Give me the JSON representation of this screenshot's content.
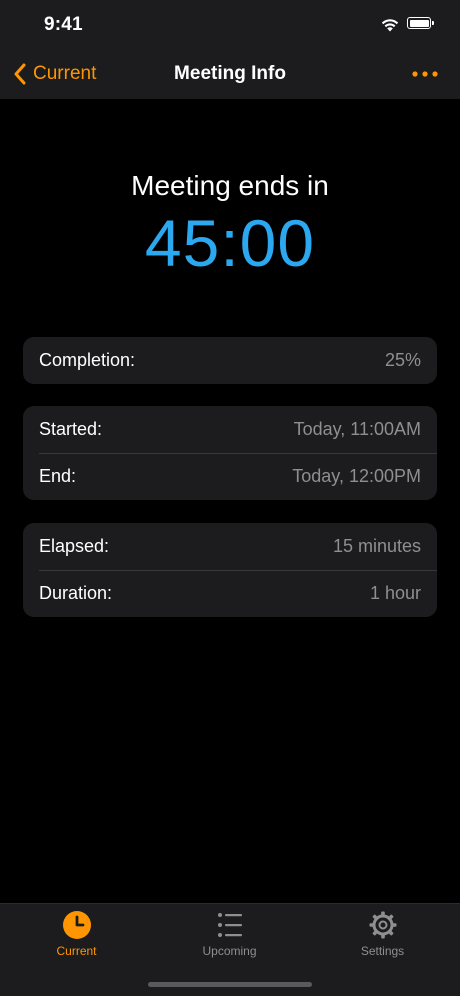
{
  "status_bar": {
    "time": "9:41"
  },
  "nav": {
    "back_label": "Current",
    "title": "Meeting Info"
  },
  "main": {
    "headline": "Meeting ends in",
    "countdown": "45:00"
  },
  "cards": [
    {
      "rows": [
        {
          "label": "Completion:",
          "value": "25%"
        }
      ]
    },
    {
      "rows": [
        {
          "label": "Started:",
          "value": "Today, 11:00AM"
        },
        {
          "label": "End:",
          "value": "Today, 12:00PM"
        }
      ]
    },
    {
      "rows": [
        {
          "label": "Elapsed:",
          "value": "15 minutes"
        },
        {
          "label": "Duration:",
          "value": "1 hour"
        }
      ]
    }
  ],
  "tabs": [
    {
      "label": "Current",
      "icon": "clock-icon",
      "active": true
    },
    {
      "label": "Upcoming",
      "icon": "list-icon",
      "active": false
    },
    {
      "label": "Settings",
      "icon": "gear-icon",
      "active": false
    }
  ],
  "colors": {
    "accent": "#ff9500",
    "countdown": "#2ba8ef",
    "card_background": "#1c1c1e",
    "secondary_text": "#8e8e93"
  }
}
